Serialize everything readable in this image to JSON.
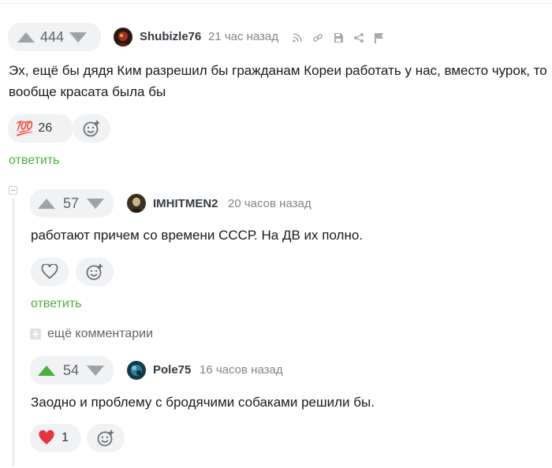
{
  "comments": [
    {
      "rating": "444",
      "author": "Shubizle76",
      "time": "21 час назад",
      "text": "Эх, ещё бы дядя Ким разрешил бы гражданам Кореи работать у нас, вместо чурок, то вообще красата была бы",
      "reaction_count": "26",
      "reaction_emoji": "💯",
      "reply_label": "ответить"
    },
    {
      "rating": "57",
      "author": "IMHITMEN2",
      "time": "20 часов назад",
      "text": "работают причем со времени СССР. На ДВ их полно.",
      "reply_label": "ответить"
    },
    {
      "rating": "54",
      "author": "Pole75",
      "time": "16 часов назад",
      "text": "Заодно и проблему с бродячими собаками решили бы.",
      "reaction_count": "1"
    }
  ],
  "more_comments_label": "ещё комментарии",
  "colors": {
    "accent_green": "#4caf3f",
    "heart_red": "#e4343f",
    "arrow_gray": "#9ea3a9"
  }
}
